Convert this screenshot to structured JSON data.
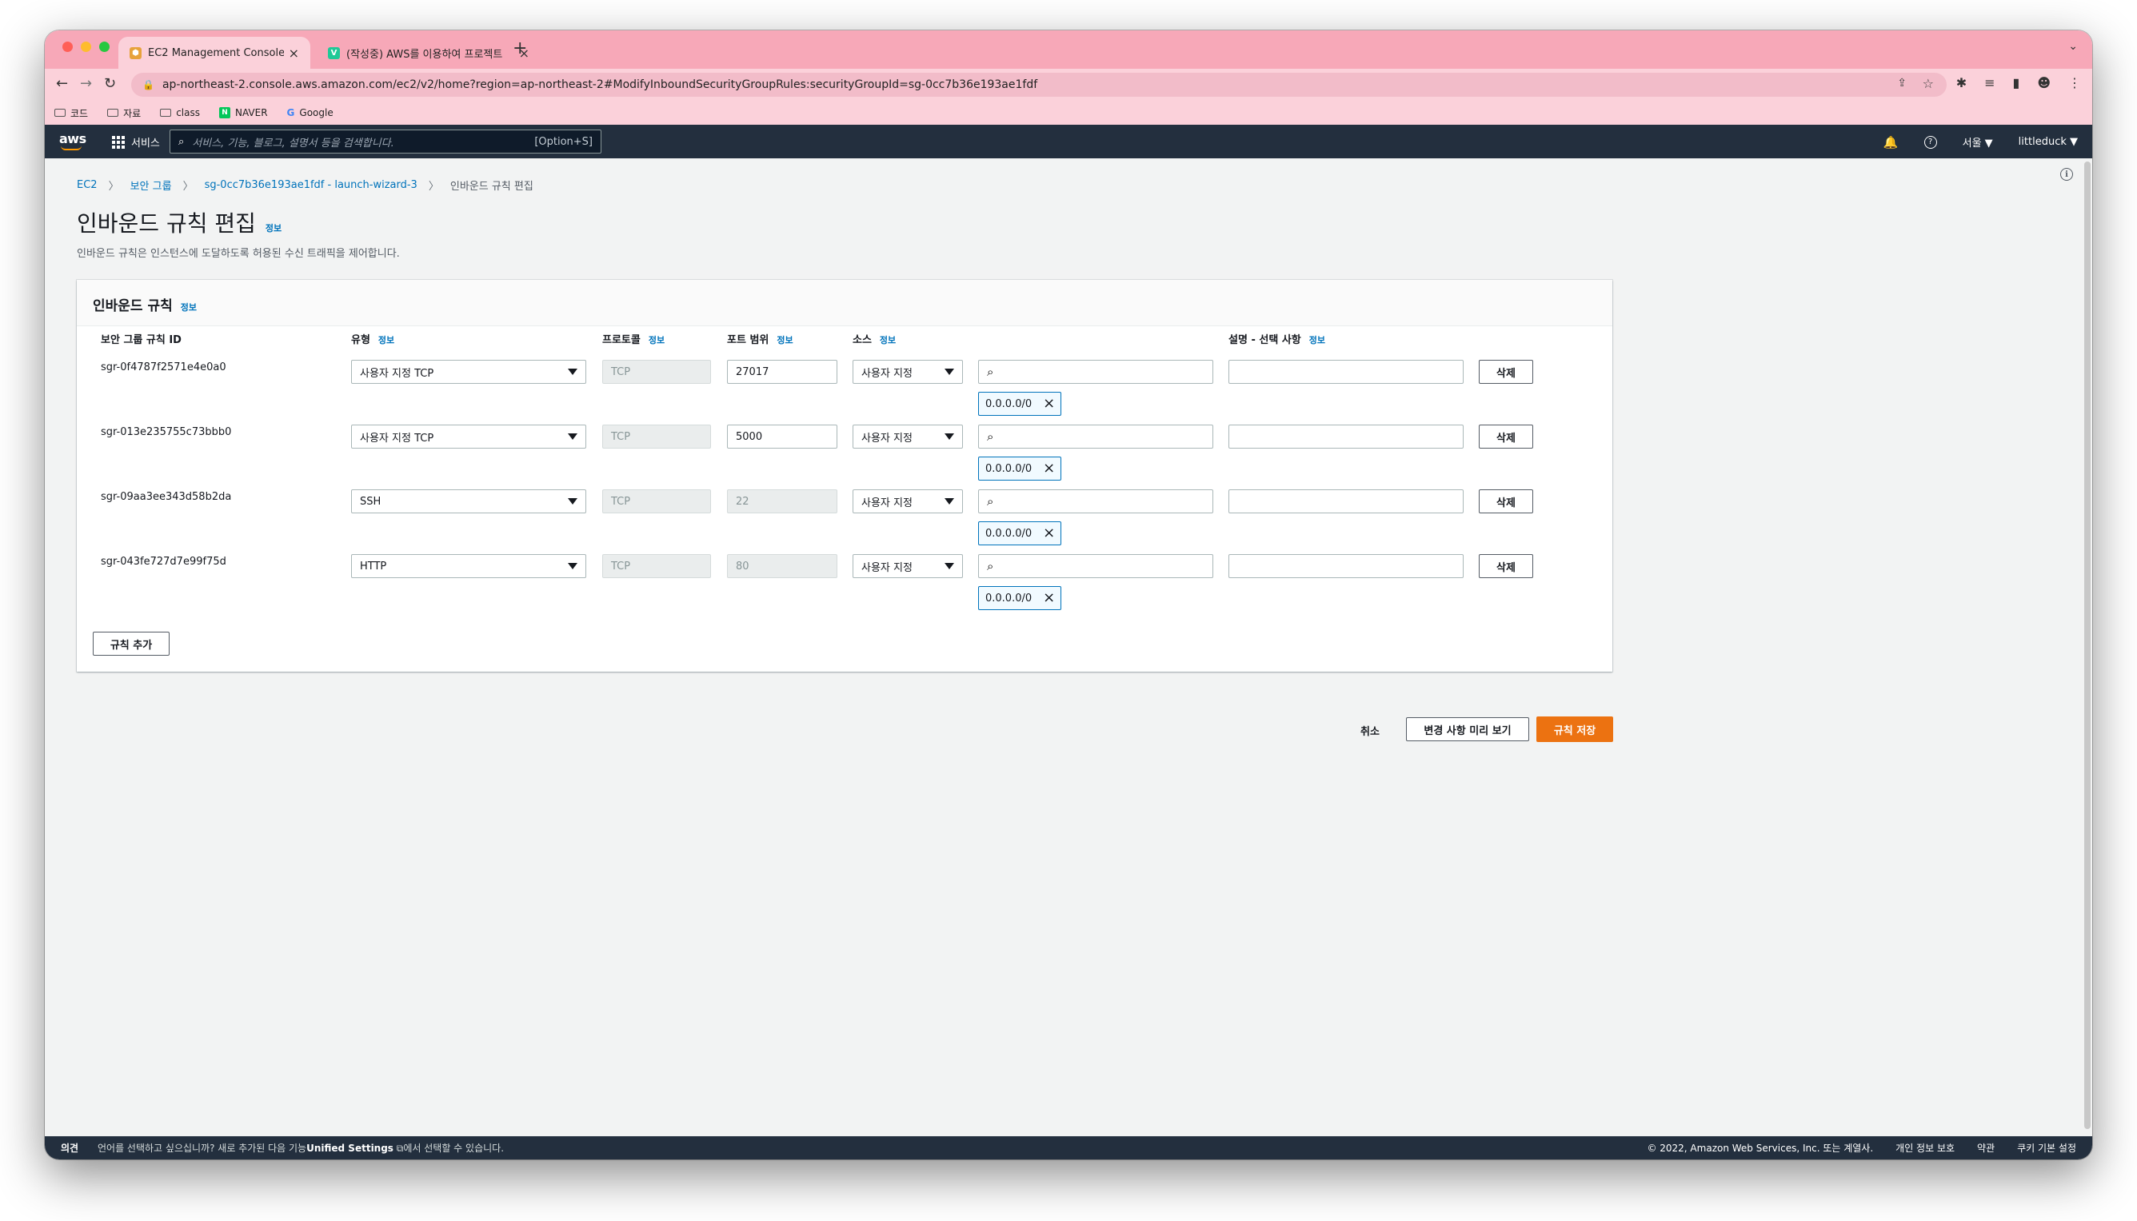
{
  "browser": {
    "tabs": [
      {
        "title": "EC2 Management Console",
        "favicon": "ec2-icon",
        "color": "#e7a23b"
      },
      {
        "title": "(작성중) AWS를 이용하여 프로젝트 ",
        "favicon": "velog-icon",
        "color": "#20c997"
      }
    ],
    "url": "ap-northeast-2.console.aws.amazon.com/ec2/v2/home?region=ap-northeast-2#ModifyInboundSecurityGroupRules:securityGroupId=sg-0cc7b36e193ae1fdf",
    "bookmarks": [
      "코드",
      "자료",
      "class",
      "NAVER",
      "Google"
    ]
  },
  "awsnav": {
    "logo": "aws",
    "services": "서비스",
    "search_placeholder": "서비스, 기능, 블로그, 설명서 등을 검색합니다.",
    "search_shortcut": "[Option+S]",
    "region": "서울 ▼",
    "user": "littleduck ▼"
  },
  "breadcrumb": {
    "items": [
      "EC2",
      "보안 그룹",
      "sg-0cc7b36e193ae1fdf - launch-wizard-3"
    ],
    "current": "인바운드 규칙 편집"
  },
  "page": {
    "title": "인바운드 규칙 편집",
    "info": "정보",
    "description": "인바운드 규칙은 인스턴스에 도달하도록 허용된 수신 트래픽을 제어합니다."
  },
  "panel": {
    "title": "인바운드 규칙",
    "info": "정보",
    "columns": {
      "rule_id": "보안 그룹 규칙 ID",
      "type": "유형",
      "protocol": "프로토콜",
      "port": "포트 범위",
      "source": "소스",
      "description": "설명 - 선택 사항",
      "info": "정보"
    },
    "rows": [
      {
        "id": "sgr-0f4787f2571e4e0a0",
        "type": "사용자 지정 TCP",
        "protocol": "TCP",
        "port": "27017",
        "source": "사용자 지정",
        "cidr": "0.0.0.0/0",
        "delete": "삭제"
      },
      {
        "id": "sgr-013e235755c73bbb0",
        "type": "사용자 지정 TCP",
        "protocol": "TCP",
        "port": "5000",
        "source": "사용자 지정",
        "cidr": "0.0.0.0/0",
        "delete": "삭제"
      },
      {
        "id": "sgr-09aa3ee343d58b2da",
        "type": "SSH",
        "protocol": "TCP",
        "port": "22",
        "source": "사용자 지정",
        "cidr": "0.0.0.0/0",
        "delete": "삭제"
      },
      {
        "id": "sgr-043fe727d7e99f75d",
        "type": "HTTP",
        "protocol": "TCP",
        "port": "80",
        "source": "사용자 지정",
        "cidr": "0.0.0.0/0",
        "delete": "삭제"
      }
    ],
    "add_rule": "규칙 추가"
  },
  "actions": {
    "cancel": "취소",
    "preview": "변경 사항 미리 보기",
    "save": "규칙 저장"
  },
  "footer": {
    "feedback": "의견",
    "message_pre": "언어를 선택하고 싶으십니까? 새로 추가된 다음 기능",
    "message_link": "Unified Settings",
    "message_post": "에서 선택할 수 있습니다.",
    "copyright": "© 2022, Amazon Web Services, Inc. 또는 계열사.",
    "privacy": "개인 정보 보호",
    "terms": "약관",
    "cookies": "쿠키 기본 설정"
  },
  "colors": {
    "accent": "#ec7211",
    "link": "#0073bb",
    "nav": "#232f3e"
  }
}
